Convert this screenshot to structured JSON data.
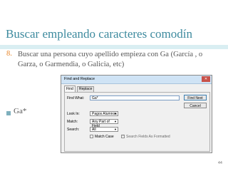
{
  "slide": {
    "title": "Buscar empleando caracteres comodín",
    "bullet1_number": "8.",
    "bullet1_text": "Buscar una persona cuyo apellido empieza con Ga (García , o Garza, o Garmendia, o Galicia,  etc)",
    "bullet2_text": "Ga*",
    "page_number": "44"
  },
  "dialog": {
    "title": "Find and Replace",
    "close_label": "✕",
    "tabs": [
      "Find",
      "Replace"
    ],
    "find_what_label": "Find What:",
    "find_what_value": "Ga*",
    "look_in_label": "Look In:",
    "look_in_value": "Pagos Alumnos",
    "match_label": "Match:",
    "match_value": "Any Part of Field",
    "search_label": "Search:",
    "search_value": "All",
    "match_case_label": "Match Case",
    "search_fields_label": "Search Fields As Formatted",
    "find_next_label": "Find Next",
    "cancel_label": "Cancel"
  }
}
